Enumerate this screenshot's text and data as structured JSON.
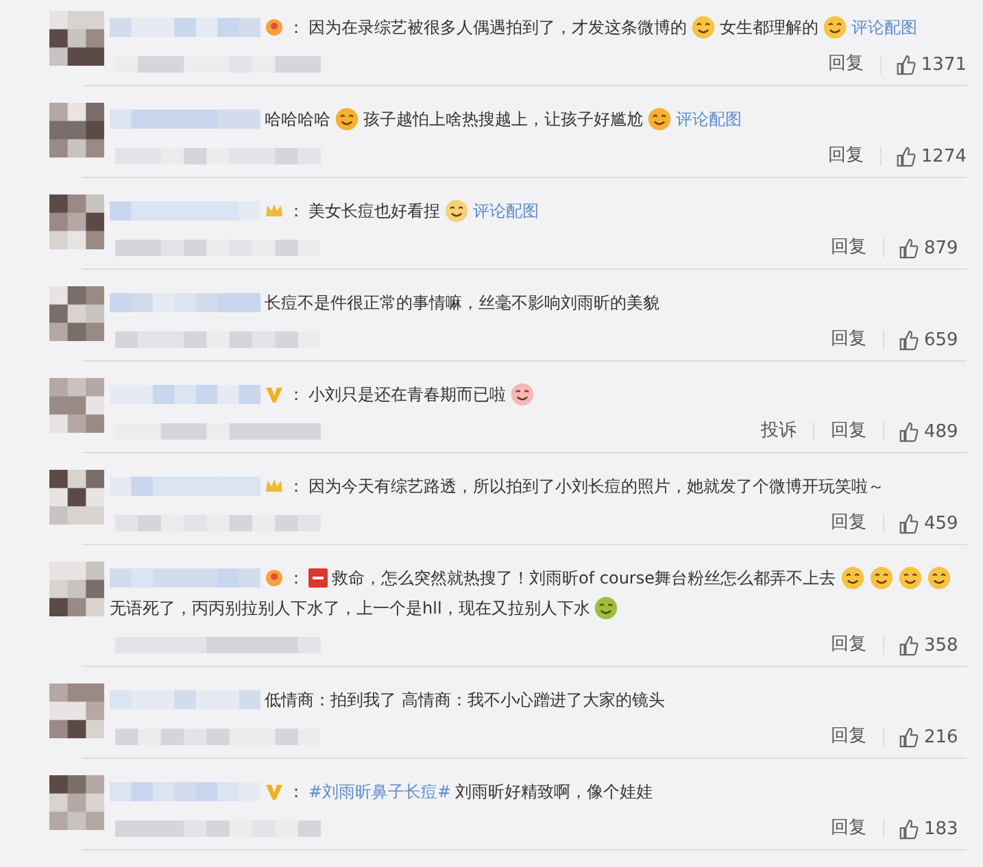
{
  "comments": [
    {
      "badge": {
        "kind": "heart"
      },
      "colon": "：",
      "parts": [
        {
          "kind": "text",
          "text": "因为在录综艺被很多人偶遇拍到了，才发这条微博的"
        },
        {
          "kind": "emoji",
          "color": "#f6c343"
        },
        {
          "kind": "text",
          "text": "女生都理解的"
        },
        {
          "kind": "emoji",
          "color": "#f6c343"
        },
        {
          "kind": "link",
          "text": "评论配图"
        }
      ],
      "actions": [
        "回复"
      ],
      "likes": "1371"
    },
    {
      "parts": [
        {
          "kind": "text",
          "text": "哈哈哈哈"
        },
        {
          "kind": "emoji",
          "color": "#f6b030"
        },
        {
          "kind": "text",
          "text": "孩子越怕上啥热搜越上，让孩子好尴尬"
        },
        {
          "kind": "emoji",
          "color": "#f6b030"
        },
        {
          "kind": "link",
          "text": "评论配图"
        }
      ],
      "actions": [
        "回复"
      ],
      "likes": "1274"
    },
    {
      "badge": {
        "kind": "crown"
      },
      "colon": "：",
      "parts": [
        {
          "kind": "text",
          "text": "美女长痘也好看捏"
        },
        {
          "kind": "emoji",
          "color": "#f3d27a"
        },
        {
          "kind": "link",
          "text": "评论配图"
        }
      ],
      "actions": [
        "回复"
      ],
      "likes": "879"
    },
    {
      "parts": [
        {
          "kind": "text",
          "text": "长痘不是件很正常的事情嘛，丝毫不影响刘雨昕的美貌"
        }
      ],
      "actions": [
        "回复"
      ],
      "likes": "659"
    },
    {
      "badge": {
        "kind": "v"
      },
      "colon": "：",
      "parts": [
        {
          "kind": "text",
          "text": "小刘只是还在青春期而已啦"
        },
        {
          "kind": "emoji",
          "color": "#f5b8b8"
        }
      ],
      "actions": [
        "投诉",
        "回复"
      ],
      "likes": "489"
    },
    {
      "badge": {
        "kind": "crown"
      },
      "colon": "：",
      "parts": [
        {
          "kind": "text",
          "text": "因为今天有综艺路透，所以拍到了小刘长痘的照片，她就发了个微博开玩笑啦～"
        }
      ],
      "actions": [
        "回复"
      ],
      "likes": "459"
    },
    {
      "badge": {
        "kind": "heart"
      },
      "colon": "：",
      "parts": [
        {
          "kind": "sos"
        },
        {
          "kind": "text",
          "text": "救命，怎么突然就热搜了！刘雨昕of course舞台粉丝怎么都弄不上去"
        },
        {
          "kind": "emoji",
          "color": "#f6c343"
        },
        {
          "kind": "emoji",
          "color": "#f6c343"
        },
        {
          "kind": "emoji",
          "color": "#f6c343"
        },
        {
          "kind": "emoji",
          "color": "#f6c343"
        },
        {
          "kind": "text",
          "text": "无语死了，丙丙别拉别人下水了，上一个是hll，现在又拉别人下水"
        },
        {
          "kind": "emoji",
          "color": "#9bbf3a"
        }
      ],
      "actions": [
        "回复"
      ],
      "likes": "358"
    },
    {
      "parts": [
        {
          "kind": "text",
          "text": "低情商：拍到我了 高情商：我不小心蹭进了大家的镜头"
        }
      ],
      "actions": [
        "回复"
      ],
      "likes": "216"
    },
    {
      "badge": {
        "kind": "v"
      },
      "colon": "：",
      "parts": [
        {
          "kind": "link",
          "text": "#刘雨昕鼻子长痘#"
        },
        {
          "kind": "text",
          "text": " 刘雨昕好精致啊，像个娃娃"
        }
      ],
      "actions": [
        "回复"
      ],
      "likes": "183"
    }
  ]
}
